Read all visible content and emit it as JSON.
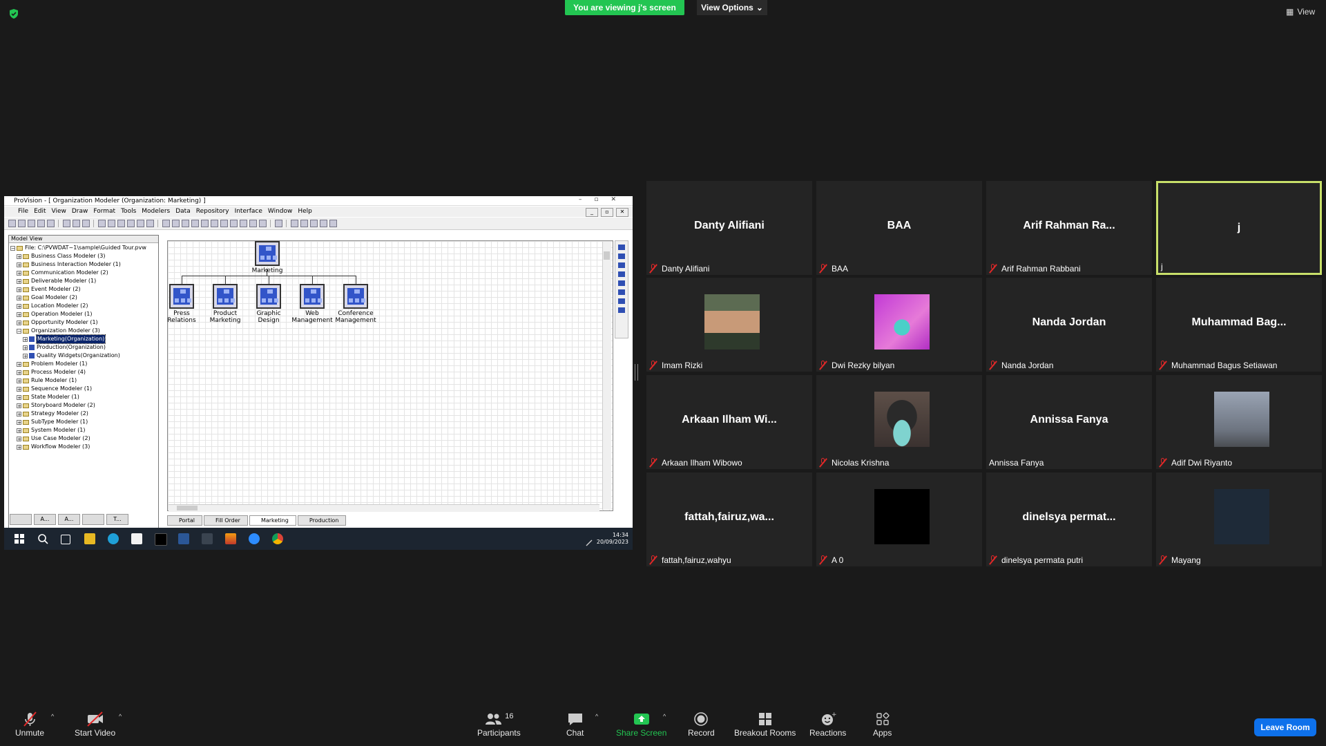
{
  "banner": {
    "viewing": "You are viewing j's screen",
    "view_options": "View Options",
    "view": "View"
  },
  "shared": {
    "title": "ProVision - [ Organization Modeler (Organization: Marketing) ]",
    "menu": [
      "File",
      "Edit",
      "View",
      "Draw",
      "Format",
      "Tools",
      "Modelers",
      "Data",
      "Repository",
      "Interface",
      "Window",
      "Help"
    ],
    "model_view": {
      "header": "Model View",
      "file": "File: C:\\PVWDAT~1\\sample\\Guided Tour.pvw",
      "items": [
        "Business Class Modeler (3)",
        "Business Interaction Modeler (1)",
        "Communication Modeler (2)",
        "Deliverable Modeler (1)",
        "Event Modeler (2)",
        "Goal Modeler (2)",
        "Location Modeler (2)",
        "Operation Modeler (1)",
        "Opportunity Modeler (1)",
        "Organization Modeler (3)"
      ],
      "org_children": [
        "Marketing(Organization)",
        "Production(Organization)",
        "Quality Widgets(Organization)"
      ],
      "items_after": [
        "Problem Modeler (1)",
        "Process Modeler (4)",
        "Rule Modeler (1)",
        "Sequence Modeler (1)",
        "State Modeler (1)",
        "Storyboard Modeler (2)",
        "Strategy Modeler (2)",
        "SubType Modeler (1)",
        "System Modeler (1)",
        "Use Case Modeler (2)",
        "Workflow Modeler (3)"
      ],
      "tabs": [
        "",
        "A...",
        "A...",
        "",
        "T..."
      ]
    },
    "diagram": {
      "root": "Marketing",
      "children": [
        {
          "l1": "Press",
          "l2": "Relations"
        },
        {
          "l1": "Product",
          "l2": "Marketing"
        },
        {
          "l1": "Graphic",
          "l2": "Design"
        },
        {
          "l1": "Web",
          "l2": "Management"
        },
        {
          "l1": "Conference",
          "l2": "Management"
        }
      ]
    },
    "doc_tabs": [
      "Portal",
      "Fill Order",
      "Marketing",
      "Production"
    ],
    "clock": {
      "time": "14:34",
      "date": "20/09/2023"
    }
  },
  "participants": [
    {
      "name": "Danty Alifiani",
      "label": "Danty Alifiani",
      "muted": true
    },
    {
      "name": "BAA",
      "label": "BAA",
      "muted": true
    },
    {
      "name": "Arif Rahman Ra...",
      "label": "Arif Rahman Rabbani",
      "muted": true
    },
    {
      "name": "j",
      "label": "j",
      "muted": false,
      "active": true
    },
    {
      "name": "",
      "label": "Imam Rizki",
      "muted": true,
      "video": "face-photo"
    },
    {
      "name": "",
      "label": "Dwi Rezky bilyan",
      "muted": true,
      "video": "snake-art"
    },
    {
      "name": "Nanda Jordan",
      "label": "Nanda Jordan",
      "muted": true
    },
    {
      "name": "Muhammad Bag...",
      "label": "Muhammad Bagus Setiawan",
      "muted": true
    },
    {
      "name": "Arkaan Ilham Wi...",
      "label": "Arkaan Ilham Wibowo",
      "muted": true
    },
    {
      "name": "",
      "label": "Nicolas Krishna",
      "muted": true,
      "video": "masked-face"
    },
    {
      "name": "Annissa Fanya",
      "label": "Annissa Fanya",
      "muted": false
    },
    {
      "name": "",
      "label": "Adif Dwi Riyanto",
      "muted": true,
      "video": "eiffel-photo"
    },
    {
      "name": "fattah,fairuz,wa...",
      "label": "fattah,fairuz,wahyu",
      "muted": true
    },
    {
      "name": "",
      "label": "A 0",
      "muted": true,
      "video": "black"
    },
    {
      "name": "dinelsya permat...",
      "label": "dinelsya permata putri",
      "muted": true
    },
    {
      "name": "",
      "label": "Mayang",
      "muted": true,
      "video": "dark-blue"
    }
  ],
  "toolbar": {
    "unmute": "Unmute",
    "start_video": "Start Video",
    "participants": "Participants",
    "participants_count": "16",
    "chat": "Chat",
    "share_screen": "Share Screen",
    "record": "Record",
    "breakout_rooms": "Breakout Rooms",
    "reactions": "Reactions",
    "apps": "Apps",
    "leave": "Leave Room"
  },
  "colors": {
    "banner_green": "#23c552",
    "leave_blue": "#0e71eb",
    "active_border": "#c8e06a",
    "muted_red": "#e02828"
  }
}
